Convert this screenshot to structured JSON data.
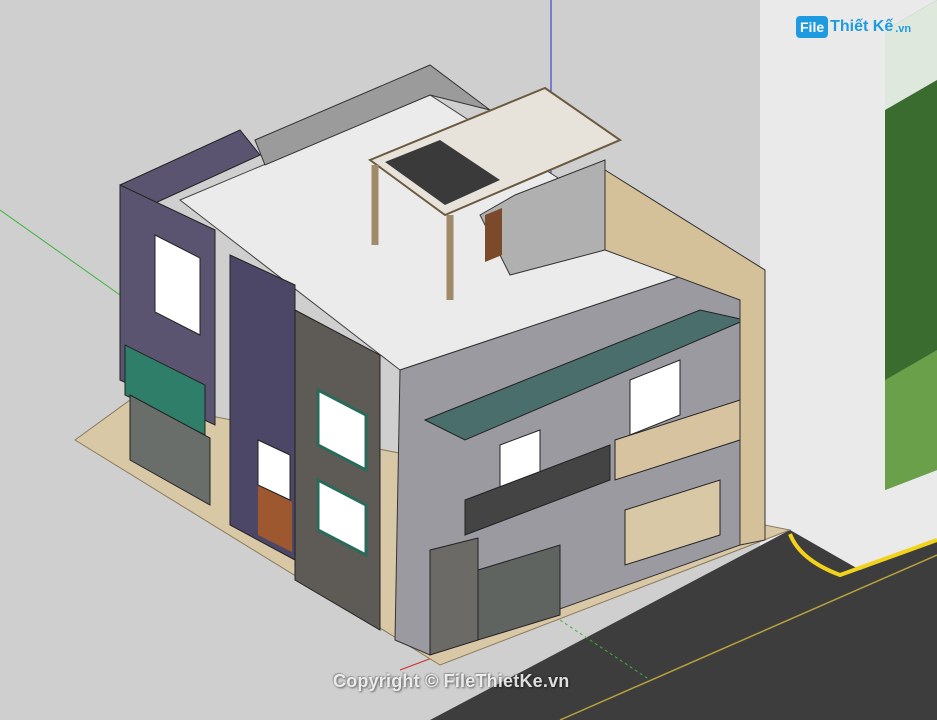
{
  "logo": {
    "badge": "File",
    "rest": "Thiết Kế",
    "suffix": ".vn"
  },
  "watermark": "Copyright © FileThietKe.vn",
  "colors": {
    "background": "#cfcfcf",
    "ground": "#eaeaea",
    "road": "#3d3d3d",
    "curb_line": "#f2d21a",
    "axis_blue": "#2a2acf",
    "axis_green": "#3cb43c",
    "axis_red": "#cf2a2a",
    "logo_blue": "#1e9be0"
  }
}
